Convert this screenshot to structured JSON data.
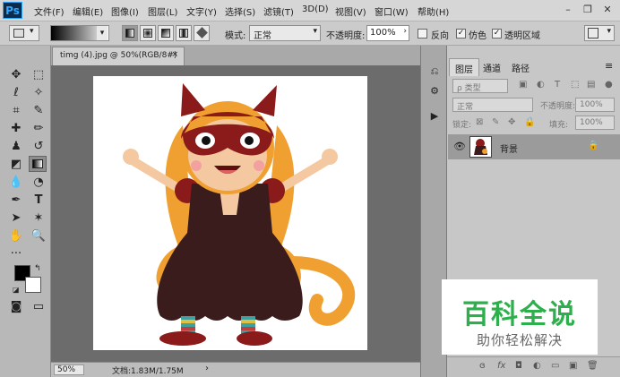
{
  "app": {
    "logo": "Ps"
  },
  "menubar": {
    "items": [
      "文件(F)",
      "编辑(E)",
      "图像(I)",
      "图层(L)",
      "文字(Y)",
      "选择(S)",
      "滤镜(T)",
      "3D(D)",
      "视图(V)",
      "窗口(W)",
      "帮助(H)"
    ],
    "window_controls": {
      "minimize": "–",
      "restore": "❐",
      "close": "✕"
    }
  },
  "options": {
    "mode_label": "模式:",
    "mode_value": "正常",
    "opacity_label": "不透明度:",
    "opacity_value": "100%",
    "reverse_label": "反向",
    "dither_label": "仿色",
    "transparency_label": "透明区域",
    "reverse_checked": false,
    "dither_checked": true,
    "transparency_checked": true
  },
  "document": {
    "tab_title": "timg (4).jpg @ 50%(RGB/8#)",
    "tab_close": "×",
    "zoom": "50%",
    "doc_info": "文档:1.83M/1.75M",
    "arrow": "›"
  },
  "layers_panel": {
    "tabs": [
      "图层",
      "通道",
      "路径"
    ],
    "active_tab": "图层",
    "filter_placeholder": "ρ 类型",
    "blend_mode": "正常",
    "opacity_label": "不透明度:",
    "opacity_value": "100%",
    "lock_label": "锁定:",
    "fill_label": "填充:",
    "fill_value": "100%",
    "layer_name": "背景",
    "bottom_icons": [
      "ɞ",
      "fx",
      "◘",
      "◐",
      "▭",
      "▣",
      "🗑"
    ]
  },
  "watermark": {
    "title": "百科全说",
    "subtitle": "助你轻松解决"
  },
  "colors": {
    "green": "#2db04b",
    "ps_blue": "#31a8ff",
    "dress": "#3a1c1c",
    "mask": "#8b1a1a",
    "hair": "#f0a030"
  }
}
